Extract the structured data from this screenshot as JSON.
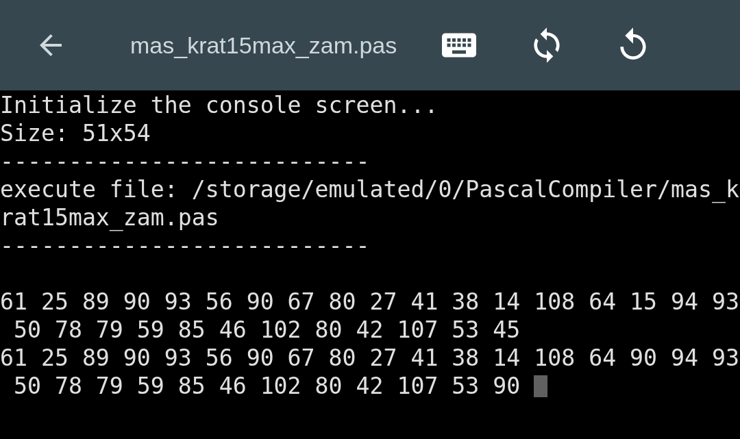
{
  "toolbar": {
    "title": "mas_krat15max_zam.pas"
  },
  "console": {
    "lines": [
      {
        "kind": "text",
        "text": "Initialize the console screen..."
      },
      {
        "kind": "text",
        "text": "Size: 51x54"
      },
      {
        "kind": "text",
        "text": "---------------------------"
      },
      {
        "kind": "text",
        "text": "execute file: /storage/emulated/0/PascalCompiler/mas_k"
      },
      {
        "kind": "text",
        "text": "rat15max_zam.pas"
      },
      {
        "kind": "text",
        "text": "---------------------------"
      },
      {
        "kind": "blank"
      },
      {
        "kind": "text",
        "text": "61 25 89 90 93 56 90 67 80 27 41 38 14 108 64 15 94 93"
      },
      {
        "kind": "text",
        "text": " 50 78 79 59 85 46 102 80 42 107 53 45"
      },
      {
        "kind": "text",
        "text": "61 25 89 90 93 56 90 67 80 27 41 38 14 108 64 90 94 93"
      },
      {
        "kind": "cursor",
        "text": " 50 78 79 59 85 46 102 80 42 107 53 90"
      }
    ]
  }
}
